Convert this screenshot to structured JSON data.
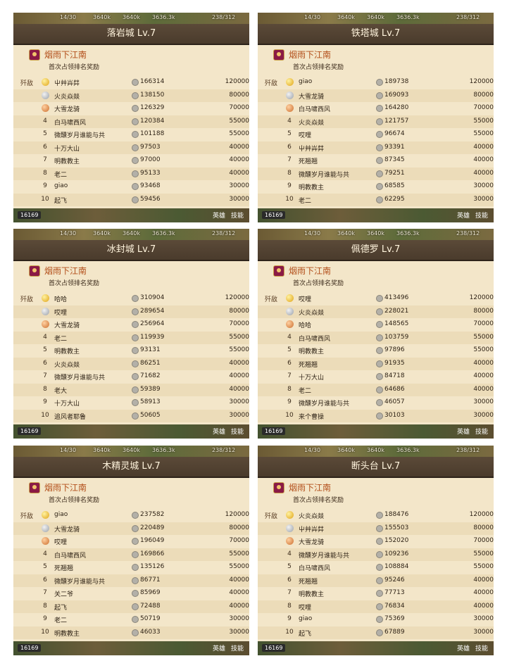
{
  "common": {
    "topbar": [
      "14/30",
      "3640k",
      "3640k",
      "3636.3k",
      "238/312"
    ],
    "alliance": "烟雨下江南",
    "subtitle": "首次占领排名奖励",
    "left_label": "歼敌",
    "bottom_number": "16169",
    "hero_label": "英雄",
    "skill_label": "技能"
  },
  "panels": [
    {
      "title": "落岩城 Lv.7",
      "rows": [
        {
          "rank": "1",
          "name": "屮艸芔茻",
          "score": "166314",
          "reward": "120000"
        },
        {
          "rank": "2",
          "name": "火炎焱燚",
          "score": "138150",
          "reward": "80000"
        },
        {
          "rank": "3",
          "name": "大雪龙骑",
          "score": "126329",
          "reward": "70000"
        },
        {
          "rank": "4",
          "name": "白马啸西风",
          "score": "120384",
          "reward": "55000"
        },
        {
          "rank": "5",
          "name": "微醺岁月谁能与共",
          "score": "101188",
          "reward": "55000"
        },
        {
          "rank": "6",
          "name": "十万大山",
          "score": "97503",
          "reward": "40000"
        },
        {
          "rank": "7",
          "name": "明教教主",
          "score": "97000",
          "reward": "40000"
        },
        {
          "rank": "8",
          "name": "老二",
          "score": "95133",
          "reward": "40000"
        },
        {
          "rank": "9",
          "name": "giao",
          "score": "93468",
          "reward": "30000"
        },
        {
          "rank": "10",
          "name": "起飞",
          "score": "59456",
          "reward": "30000"
        }
      ]
    },
    {
      "title": "铁塔城 Lv.7",
      "rows": [
        {
          "rank": "1",
          "name": "giao",
          "score": "189738",
          "reward": "120000"
        },
        {
          "rank": "2",
          "name": "大雪龙骑",
          "score": "169093",
          "reward": "80000"
        },
        {
          "rank": "3",
          "name": "白马啸西风",
          "score": "164280",
          "reward": "70000"
        },
        {
          "rank": "4",
          "name": "火炎焱燚",
          "score": "121757",
          "reward": "55000"
        },
        {
          "rank": "5",
          "name": "哎哩",
          "score": "96674",
          "reward": "55000"
        },
        {
          "rank": "6",
          "name": "屮艸芔茻",
          "score": "93391",
          "reward": "40000"
        },
        {
          "rank": "7",
          "name": "死翘翘",
          "score": "87345",
          "reward": "40000"
        },
        {
          "rank": "8",
          "name": "微醺岁月谁能与共",
          "score": "79251",
          "reward": "40000"
        },
        {
          "rank": "9",
          "name": "明教教主",
          "score": "68585",
          "reward": "30000"
        },
        {
          "rank": "10",
          "name": "老二",
          "score": "62295",
          "reward": "30000"
        }
      ]
    },
    {
      "title": "冰封城 Lv.7",
      "rows": [
        {
          "rank": "1",
          "name": "哈哈",
          "score": "310904",
          "reward": "120000"
        },
        {
          "rank": "2",
          "name": "哎哩",
          "score": "289654",
          "reward": "80000"
        },
        {
          "rank": "3",
          "name": "大雪龙骑",
          "score": "256964",
          "reward": "70000"
        },
        {
          "rank": "4",
          "name": "老二",
          "score": "119939",
          "reward": "55000"
        },
        {
          "rank": "5",
          "name": "明教教主",
          "score": "93131",
          "reward": "55000"
        },
        {
          "rank": "6",
          "name": "火炎焱燚",
          "score": "86251",
          "reward": "40000"
        },
        {
          "rank": "7",
          "name": "微醺岁月谁能与共",
          "score": "71682",
          "reward": "40000"
        },
        {
          "rank": "8",
          "name": "老大",
          "score": "59389",
          "reward": "40000"
        },
        {
          "rank": "9",
          "name": "十万大山",
          "score": "58913",
          "reward": "30000"
        },
        {
          "rank": "10",
          "name": "追风者耶鲁",
          "score": "50605",
          "reward": "30000"
        }
      ]
    },
    {
      "title": "佩德罗 Lv.7",
      "rows": [
        {
          "rank": "1",
          "name": "哎哩",
          "score": "413496",
          "reward": "120000"
        },
        {
          "rank": "2",
          "name": "火炎焱燚",
          "score": "228021",
          "reward": "80000"
        },
        {
          "rank": "3",
          "name": "哈哈",
          "score": "148565",
          "reward": "70000"
        },
        {
          "rank": "4",
          "name": "白马啸西风",
          "score": "103759",
          "reward": "55000"
        },
        {
          "rank": "5",
          "name": "明教教主",
          "score": "97896",
          "reward": "55000"
        },
        {
          "rank": "6",
          "name": "死翘翘",
          "score": "91935",
          "reward": "40000"
        },
        {
          "rank": "7",
          "name": "十万大山",
          "score": "84718",
          "reward": "40000"
        },
        {
          "rank": "8",
          "name": "老二",
          "score": "64686",
          "reward": "40000"
        },
        {
          "rank": "9",
          "name": "微醺岁月谁能与共",
          "score": "46057",
          "reward": "30000"
        },
        {
          "rank": "10",
          "name": "来个曹操",
          "score": "30103",
          "reward": "30000"
        }
      ]
    },
    {
      "title": "木精灵城 Lv.7",
      "rows": [
        {
          "rank": "1",
          "name": "giao",
          "score": "237582",
          "reward": "120000"
        },
        {
          "rank": "2",
          "name": "大雪龙骑",
          "score": "220489",
          "reward": "80000"
        },
        {
          "rank": "3",
          "name": "哎哩",
          "score": "196049",
          "reward": "70000"
        },
        {
          "rank": "4",
          "name": "白马啸西风",
          "score": "169866",
          "reward": "55000"
        },
        {
          "rank": "5",
          "name": "死翘翘",
          "score": "135126",
          "reward": "55000"
        },
        {
          "rank": "6",
          "name": "微醺岁月谁能与共",
          "score": "86771",
          "reward": "40000"
        },
        {
          "rank": "7",
          "name": "关二爷",
          "score": "85969",
          "reward": "40000"
        },
        {
          "rank": "8",
          "name": "起飞",
          "score": "72488",
          "reward": "40000"
        },
        {
          "rank": "9",
          "name": "老二",
          "score": "50719",
          "reward": "30000"
        },
        {
          "rank": "10",
          "name": "明教教主",
          "score": "46033",
          "reward": "30000"
        }
      ]
    },
    {
      "title": "断头台 Lv.7",
      "rows": [
        {
          "rank": "1",
          "name": "火炎焱燚",
          "score": "188476",
          "reward": "120000"
        },
        {
          "rank": "2",
          "name": "屮艸芔茻",
          "score": "155503",
          "reward": "80000"
        },
        {
          "rank": "3",
          "name": "大雪龙骑",
          "score": "152020",
          "reward": "70000"
        },
        {
          "rank": "4",
          "name": "微醺岁月谁能与共",
          "score": "109236",
          "reward": "55000"
        },
        {
          "rank": "5",
          "name": "白马啸西风",
          "score": "108884",
          "reward": "55000"
        },
        {
          "rank": "6",
          "name": "死翘翘",
          "score": "95246",
          "reward": "40000"
        },
        {
          "rank": "7",
          "name": "明教教主",
          "score": "77713",
          "reward": "40000"
        },
        {
          "rank": "8",
          "name": "哎哩",
          "score": "76834",
          "reward": "40000"
        },
        {
          "rank": "9",
          "name": "giao",
          "score": "75369",
          "reward": "30000"
        },
        {
          "rank": "10",
          "name": "起飞",
          "score": "67889",
          "reward": "30000"
        }
      ]
    }
  ]
}
